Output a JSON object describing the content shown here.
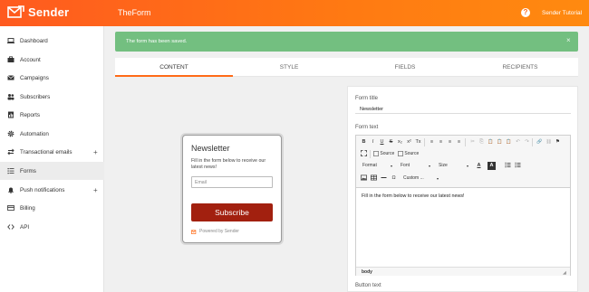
{
  "topbar": {
    "brand": "Sender",
    "app_title": "TheForm",
    "help_icon": "?",
    "account_name": "Sender Tutorial"
  },
  "sidebar": {
    "items": [
      {
        "label": "Dashboard",
        "icon": "laptop-icon"
      },
      {
        "label": "Account",
        "icon": "briefcase-icon"
      },
      {
        "label": "Campaigns",
        "icon": "envelope-icon"
      },
      {
        "label": "Subscribers",
        "icon": "users-icon"
      },
      {
        "label": "Reports",
        "icon": "report-icon"
      },
      {
        "label": "Automation",
        "icon": "gear-icon"
      },
      {
        "label": "Transactional emails",
        "icon": "swap-icon",
        "plus": "+"
      },
      {
        "label": "Forms",
        "icon": "list-icon",
        "active": true
      },
      {
        "label": "Push notifications",
        "icon": "bell-icon",
        "plus": "+"
      },
      {
        "label": "Billing",
        "icon": "card-icon"
      },
      {
        "label": "API",
        "icon": "code-icon"
      }
    ]
  },
  "alert": {
    "text": "The form has been saved.",
    "close": "×",
    "color": "#73bf80"
  },
  "tabs": [
    {
      "label": "CONTENT",
      "active": true
    },
    {
      "label": "STYLE"
    },
    {
      "label": "FIELDS"
    },
    {
      "label": "RECIPIENTS"
    }
  ],
  "preview": {
    "title": "Newsletter",
    "description": "Fill in the form below to receive our latest news!",
    "email_placeholder": "Email",
    "button_label": "Subscribe",
    "button_color": "#a2200f",
    "powered_by": "Powered by Sender"
  },
  "settings": {
    "form_title_label": "Form title",
    "form_title_value": "Newsletter",
    "form_text_label": "Form text",
    "button_text_label": "Button text",
    "editor": {
      "row1": [
        "B",
        "I",
        "U",
        "S",
        "x₂",
        "x²",
        "Tx",
        "≡",
        "≡",
        "≡",
        "≡",
        "✂",
        "⎘",
        "📋",
        "📋",
        "📋",
        "↶",
        "↷",
        "🔗",
        "⛓",
        "⚑"
      ],
      "source1": "Source",
      "source2": "Source",
      "format_label": "Format",
      "font_label": "Font",
      "size_label": "Size",
      "text_color": "A",
      "bg_color": "A",
      "custom_label": "Custom ...",
      "omega": "Ω",
      "content": "Fill in the form below to receive our latest news!",
      "status_path": "body"
    }
  },
  "colors": {
    "brand_orange": "#ff6b18",
    "alert_green": "#73bf80"
  }
}
